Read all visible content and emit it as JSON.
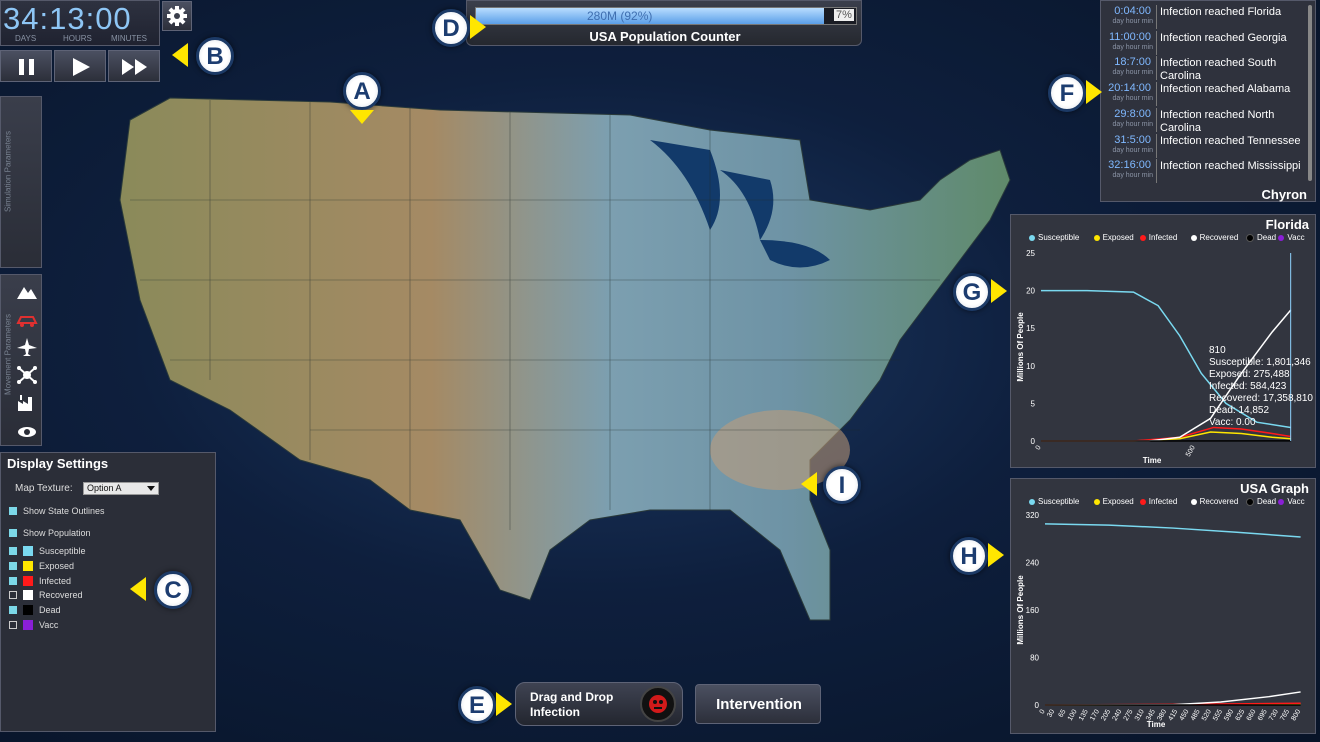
{
  "clock": {
    "value": "34:13:00",
    "units": [
      "DAYS",
      "HOURS",
      "MINUTES"
    ]
  },
  "counter": {
    "value": "280M (92%)",
    "percent": "7%",
    "label": "USA Population Counter",
    "fill": 0.92
  },
  "chyron": {
    "title": "Chyron",
    "sub": "day hour min",
    "events": [
      {
        "time": "0:04:00",
        "text": "Infection reached Florida"
      },
      {
        "time": "11:00:00",
        "text": "Infection reached Georgia"
      },
      {
        "time": "18:7:00",
        "text": "Infection reached South Carolina"
      },
      {
        "time": "20:14:00",
        "text": "Infection reached Alabama"
      },
      {
        "time": "29:8:00",
        "text": "Infection reached North Carolina"
      },
      {
        "time": "31:5:00",
        "text": "Infection reached Tennessee"
      },
      {
        "time": "32:16:00",
        "text": "Infection reached Mississippi"
      }
    ]
  },
  "side": {
    "sim_params": "Simulation Parameters",
    "move_params": "Movement Parameters"
  },
  "display": {
    "title": "Display Settings",
    "map_texture_label": "Map Texture:",
    "map_texture_value": "Option A",
    "show_outlines": "Show State Outlines",
    "show_population": "Show Population",
    "layers": [
      {
        "label": "Susceptible",
        "color": "#7ad9f0",
        "on": true
      },
      {
        "label": "Exposed",
        "color": "#ffe600",
        "on": true
      },
      {
        "label": "Infected",
        "color": "#ff1a1a",
        "on": true
      },
      {
        "label": "Recovered",
        "color": "#ffffff",
        "on": false
      },
      {
        "label": "Dead",
        "color": "#000000",
        "on": true
      },
      {
        "label": "Vacc",
        "color": "#8a1fd6",
        "on": false
      }
    ]
  },
  "bottom": {
    "drag_drop": "Drag and Drop Infection",
    "intervention": "Intervention"
  },
  "legend": [
    {
      "name": "Susceptible",
      "color": "#7ad9f0"
    },
    {
      "name": "Exposed",
      "color": "#ffe600"
    },
    {
      "name": "Infected",
      "color": "#ff1a1a"
    },
    {
      "name": "Recovered",
      "color": "#ffffff"
    },
    {
      "name": "Dead",
      "color": "#000000"
    },
    {
      "name": "Vacc",
      "color": "#8a1fd6"
    }
  ],
  "callouts": [
    "A",
    "B",
    "C",
    "D",
    "E",
    "F",
    "G",
    "H",
    "I"
  ],
  "chart_data": [
    {
      "type": "line",
      "title": "Florida",
      "ylabel": "Millions Of People",
      "xlabel": "Time",
      "ylim": [
        0,
        25
      ],
      "yticks": [
        "0",
        "5",
        "10",
        "15",
        "20",
        "25"
      ],
      "xticks": [
        "0",
        "500"
      ],
      "xlim": [
        0,
        850
      ],
      "tooltip": [
        "810",
        "Susceptible: 1,801,346",
        "Exposed: 275,488",
        "Infected: 584,423",
        "Recovered: 17,358,810",
        "Dead: 14,852",
        "Vacc: 0.00"
      ],
      "series": [
        {
          "name": "Susceptible",
          "color": "#7ad9f0",
          "x": [
            0,
            150,
            300,
            380,
            450,
            520,
            600,
            700,
            810
          ],
          "y": [
            20,
            20,
            19.8,
            18,
            14,
            9,
            5,
            2.5,
            1.8
          ]
        },
        {
          "name": "Exposed",
          "color": "#ffe600",
          "x": [
            0,
            300,
            450,
            550,
            650,
            750,
            810
          ],
          "y": [
            0,
            0,
            0.3,
            1.2,
            1.0,
            0.5,
            0.3
          ]
        },
        {
          "name": "Infected",
          "color": "#ff1a1a",
          "x": [
            0,
            300,
            450,
            560,
            650,
            750,
            810
          ],
          "y": [
            0,
            0,
            0.5,
            1.8,
            1.6,
            1.0,
            0.6
          ]
        },
        {
          "name": "Recovered",
          "color": "#ffffff",
          "x": [
            0,
            350,
            450,
            550,
            650,
            750,
            810
          ],
          "y": [
            0,
            0,
            0.5,
            3,
            9,
            14.5,
            17.4
          ]
        },
        {
          "name": "Dead",
          "color": "#000000",
          "x": [
            0,
            810
          ],
          "y": [
            0,
            0.01
          ]
        }
      ]
    },
    {
      "type": "line",
      "title": "USA Graph",
      "ylabel": "Millions Of People",
      "xlabel": "Time",
      "ylim": [
        0,
        320
      ],
      "yticks": [
        "0",
        "80",
        "160",
        "240",
        "320"
      ],
      "xticks": [
        "0",
        "30",
        "65",
        "100",
        "135",
        "170",
        "205",
        "240",
        "275",
        "310",
        "345",
        "380",
        "415",
        "450",
        "485",
        "520",
        "555",
        "590",
        "625",
        "660",
        "695",
        "730",
        "765",
        "800"
      ],
      "xlim": [
        0,
        820
      ],
      "series": [
        {
          "name": "Susceptible",
          "color": "#7ad9f0",
          "x": [
            0,
            200,
            400,
            600,
            800
          ],
          "y": [
            305,
            303,
            298,
            291,
            283
          ]
        },
        {
          "name": "Exposed",
          "color": "#ffe600",
          "x": [
            0,
            400,
            600,
            800
          ],
          "y": [
            0,
            0.5,
            1,
            1.5
          ]
        },
        {
          "name": "Infected",
          "color": "#ff1a1a",
          "x": [
            0,
            400,
            600,
            800
          ],
          "y": [
            0,
            1,
            2,
            3
          ]
        },
        {
          "name": "Recovered",
          "color": "#ffffff",
          "x": [
            0,
            400,
            550,
            700,
            800
          ],
          "y": [
            0,
            0.5,
            5,
            14,
            22
          ]
        },
        {
          "name": "Dead",
          "color": "#000000",
          "x": [
            0,
            800
          ],
          "y": [
            0,
            0.1
          ]
        }
      ]
    }
  ]
}
